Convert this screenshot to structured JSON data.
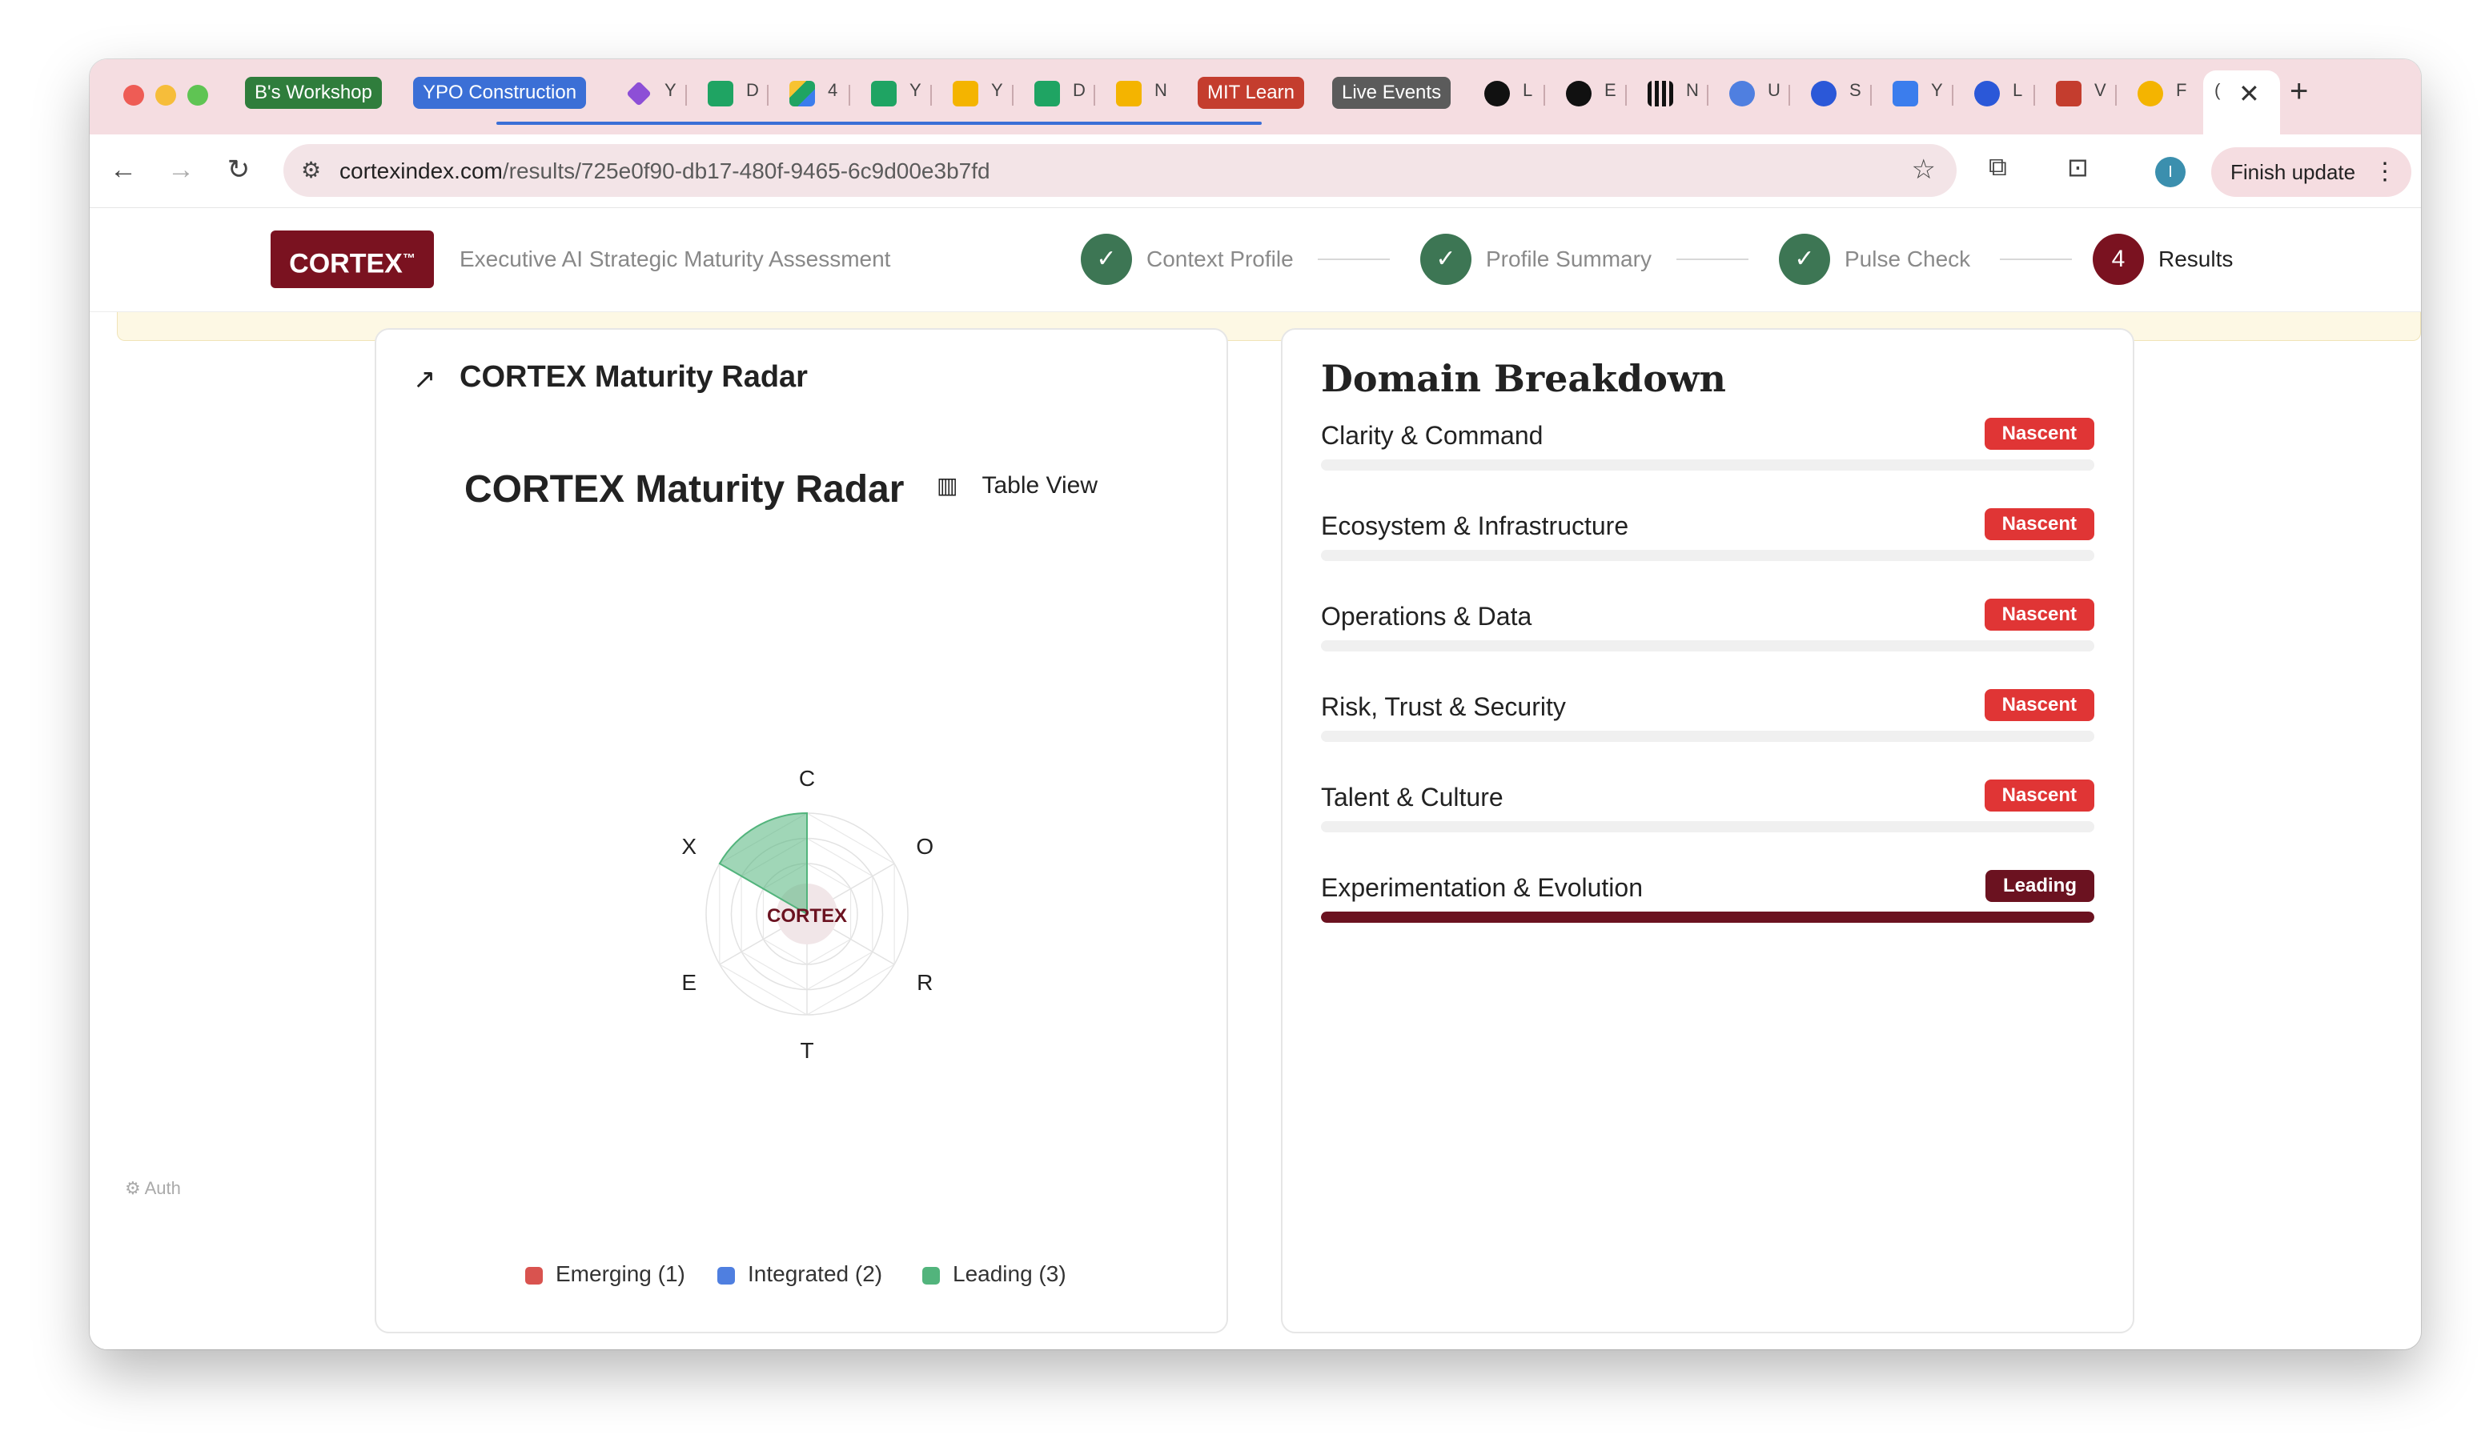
{
  "browser": {
    "tab_groups": [
      {
        "label": "B's Workshop",
        "color": "#2f7d3c"
      },
      {
        "label": "YPO Construction",
        "color": "#3b6fd6"
      },
      {
        "label": "MIT Learn",
        "color": "#c43d2e"
      },
      {
        "label": "Live Events",
        "color": "#5b5b5b"
      }
    ],
    "tab_fragments": [
      "Y",
      "D",
      "4",
      "Y",
      "Y",
      "D",
      "N",
      "L",
      "E",
      "N",
      "U",
      "S",
      "Y",
      "L",
      "V",
      "F",
      "("
    ],
    "url_host": "cortexindex.com",
    "url_path": "/results/725e0f90-db17-480f-9465-6c9d00e3b7fd",
    "profile_initial": "I",
    "finish_update": "Finish update"
  },
  "header": {
    "brand": "CORTEX",
    "brand_tm": "™",
    "subtitle": "Executive AI Strategic Maturity Assessment",
    "steps": [
      {
        "label": "Context Profile",
        "state": "done"
      },
      {
        "label": "Profile Summary",
        "state": "done"
      },
      {
        "label": "Pulse Check",
        "state": "done"
      },
      {
        "label": "Results",
        "state": "current",
        "number": "4"
      }
    ]
  },
  "radar_card": {
    "header_title": "CORTEX Maturity Radar",
    "chart_title": "CORTEX Maturity Radar",
    "table_view": "Table View",
    "center_label": "CORTEX",
    "legend": [
      {
        "label": "Emerging (1)",
        "color": "#d9534f"
      },
      {
        "label": "Integrated (2)",
        "color": "#4f7fe0"
      },
      {
        "label": "Leading (3)",
        "color": "#52b47c"
      }
    ]
  },
  "chart_data": {
    "type": "radar",
    "axes": [
      "C",
      "O",
      "R",
      "T",
      "E",
      "X"
    ],
    "values": [
      0,
      0,
      0,
      0,
      0,
      3
    ],
    "max": 3,
    "highlight_color": "#52b47c",
    "center_label": "CORTEX"
  },
  "domain_card": {
    "title": "Domain Breakdown",
    "domains": [
      {
        "name": "Clarity & Command",
        "badge": "Nascent",
        "badge_color": "#e03535",
        "progress": 0
      },
      {
        "name": "Ecosystem & Infrastructure",
        "badge": "Nascent",
        "badge_color": "#e03535",
        "progress": 0
      },
      {
        "name": "Operations & Data",
        "badge": "Nascent",
        "badge_color": "#e03535",
        "progress": 0
      },
      {
        "name": "Risk, Trust & Security",
        "badge": "Nascent",
        "badge_color": "#e03535",
        "progress": 0
      },
      {
        "name": "Talent & Culture",
        "badge": "Nascent",
        "badge_color": "#e03535",
        "progress": 0
      },
      {
        "name": "Experimentation & Evolution",
        "badge": "Leading",
        "badge_color": "#6b1220",
        "progress": 1
      }
    ]
  },
  "footer": {
    "auth": "Auth"
  }
}
